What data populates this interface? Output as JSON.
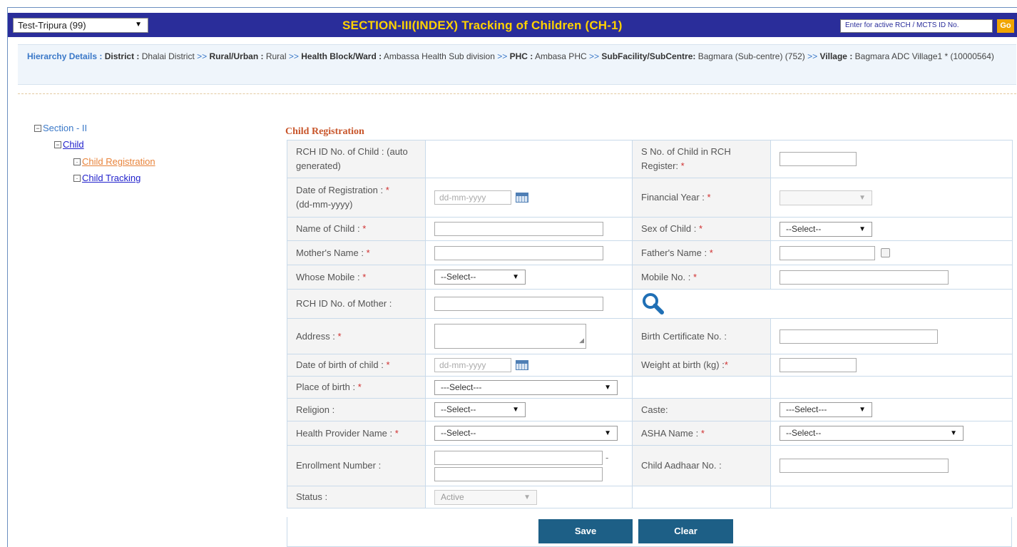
{
  "header": {
    "state_select": "Test-Tripura (99)",
    "title": "SECTION-III(INDEX) Tracking of Children (CH-1)",
    "rch_placeholder": "Enter for active RCH / MCTS ID No.",
    "go_label": "Go"
  },
  "hierarchy": {
    "label": "Hierarchy Details :",
    "sep": ">>",
    "district_label": "District :",
    "district": "Dhalai District",
    "rural_label": "Rural/Urban :",
    "rural": "Rural",
    "block_label": "Health Block/Ward :",
    "block": "Ambassa Health Sub division",
    "phc_label": "PHC :",
    "phc": "Ambasa PHC",
    "sub_label": "SubFacility/SubCentre:",
    "sub": "Bagmara (Sub-centre) (752)",
    "village_label": "Village :",
    "village": "Bagmara ADC Village1 * (10000564)"
  },
  "tree": {
    "section": "Section - II",
    "child": "Child",
    "registration": "Child Registration",
    "tracking": "Child Tracking"
  },
  "form": {
    "heading": "Child Registration",
    "req_mark": "*",
    "rch_id_label": "RCH ID No. of Child : (auto generated)",
    "sno_label": "S No. of Child in RCH Register:",
    "date_reg_label": "Date of Registration :",
    "date_reg_hint": "(dd-mm-yyyy)",
    "date_placeholder": "dd-mm-yyyy",
    "fin_year_label": "Financial Year :",
    "name_label": "Name of Child :",
    "sex_label": "Sex of Child :",
    "sex_value": "--Select--",
    "mother_label": "Mother's Name :",
    "father_label": "Father's Name :",
    "whose_mobile_label": "Whose Mobile :",
    "whose_mobile_value": "--Select--",
    "mobile_label": "Mobile No. :",
    "rch_mother_label": "RCH ID No. of Mother :",
    "address_label": "Address :",
    "birth_cert_label": "Birth Certificate No. :",
    "dob_label": "Date of birth of child :",
    "weight_label": "Weight at birth (kg) :",
    "place_label": "Place of birth :",
    "place_value": "---Select---",
    "religion_label": "Religion :",
    "religion_value": "--Select--",
    "caste_label": "Caste:",
    "caste_value": "---Select---",
    "provider_label": "Health Provider Name :",
    "provider_value": "--Select--",
    "asha_label": "ASHA Name :",
    "asha_value": "--Select--",
    "enroll_label": "Enrollment Number :",
    "enroll_dash": "-",
    "aadhaar_label": "Child Aadhaar No. :",
    "status_label": "Status :",
    "status_value": "Active"
  },
  "buttons": {
    "save": "Save",
    "clear": "Clear"
  },
  "colors": {
    "topbar": "#2a2d9a",
    "title": "#ffd200",
    "button": "#1d5f86",
    "heading": "#c8552a"
  }
}
